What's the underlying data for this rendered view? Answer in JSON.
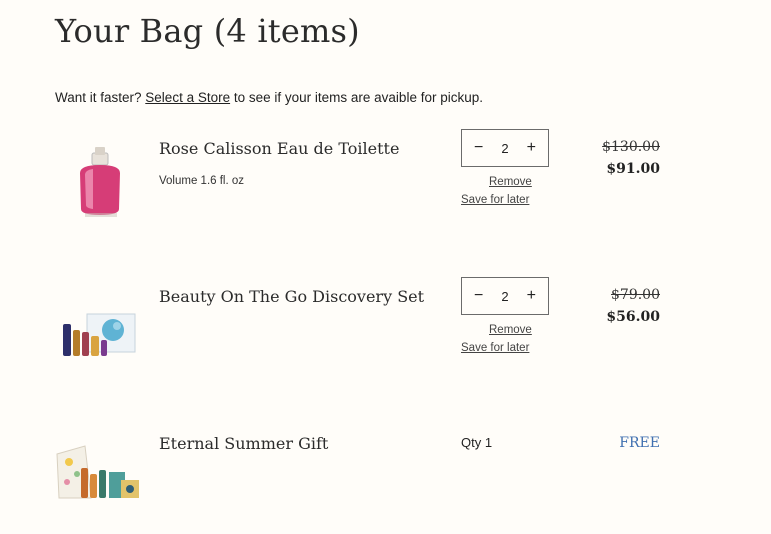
{
  "page": {
    "title": "Your Bag (4 items)"
  },
  "pickup": {
    "prefix": "Want it faster?",
    "link": "Select a Store",
    "suffix": "to see if your items are avaible for pickup."
  },
  "items": [
    {
      "name": "Rose Calisson Eau de Toilette",
      "variant": "Volume 1.6 fl. oz",
      "qty": "2",
      "minus": "−",
      "plus": "+",
      "remove": "Remove",
      "save": "Save for later",
      "price_old": "$130.00",
      "price_new": "$91.00"
    },
    {
      "name": "Beauty On The Go Discovery Set",
      "qty": "2",
      "minus": "−",
      "plus": "+",
      "remove": "Remove",
      "save": "Save for later",
      "price_old": "$79.00",
      "price_new": "$56.00"
    },
    {
      "name": "Eternal Summer Gift",
      "qty_label": "Qty 1",
      "price": "FREE"
    }
  ],
  "colors": {
    "free": "#3f6fb0",
    "accent_pink": "#d94a7a"
  }
}
